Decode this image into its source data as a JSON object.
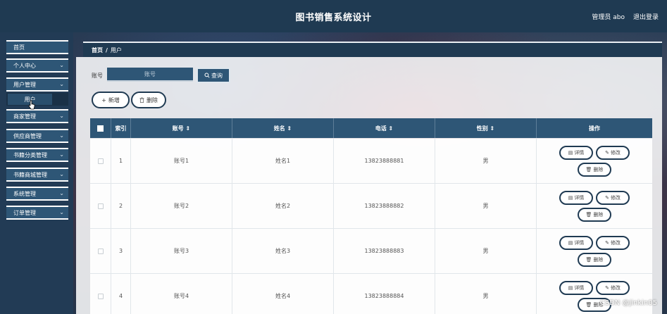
{
  "app": {
    "title": "图书销售系统设计",
    "user_label": "管理员 abo",
    "logout_label": "退出登录"
  },
  "sidebar": {
    "items": [
      {
        "label": "首页",
        "has_children": false
      },
      {
        "label": "个人中心",
        "has_children": true
      },
      {
        "label": "用户管理",
        "has_children": true
      },
      {
        "label": "商家管理",
        "has_children": true
      },
      {
        "label": "供应商管理",
        "has_children": true
      },
      {
        "label": "书籍分类管理",
        "has_children": true
      },
      {
        "label": "书籍商城管理",
        "has_children": true
      },
      {
        "label": "系统管理",
        "has_children": true
      },
      {
        "label": "订单管理",
        "has_children": true
      }
    ],
    "active_submenu": {
      "label": "用户"
    }
  },
  "breadcrumb": {
    "home": "首页",
    "separator": "/",
    "current": "用户"
  },
  "search": {
    "label": "账号",
    "placeholder": "账号",
    "button_label": "查询"
  },
  "actions": {
    "add_label": "新增",
    "delete_label": "删除"
  },
  "table": {
    "columns": {
      "index": "索引",
      "account": "账号 ⇕",
      "name": "姓名 ⇕",
      "phone": "电话 ⇕",
      "gender": "性别 ⇕",
      "ops": "操作"
    },
    "rows": [
      {
        "index": "1",
        "account": "账号1",
        "name": "姓名1",
        "phone": "13823888881",
        "gender": "男"
      },
      {
        "index": "2",
        "account": "账号2",
        "name": "姓名2",
        "phone": "13823888882",
        "gender": "男"
      },
      {
        "index": "3",
        "account": "账号3",
        "name": "姓名3",
        "phone": "13823888883",
        "gender": "男"
      },
      {
        "index": "4",
        "account": "账号4",
        "name": "姓名4",
        "phone": "13823888884",
        "gender": "男"
      }
    ],
    "row_actions": {
      "detail": "详情",
      "edit": "修改",
      "remove": "删除"
    }
  },
  "watermark": "CSDN @jinkin05",
  "colors": {
    "primary": "#2e5676",
    "header": "#1f3a52",
    "sidebar": "#223b55"
  }
}
